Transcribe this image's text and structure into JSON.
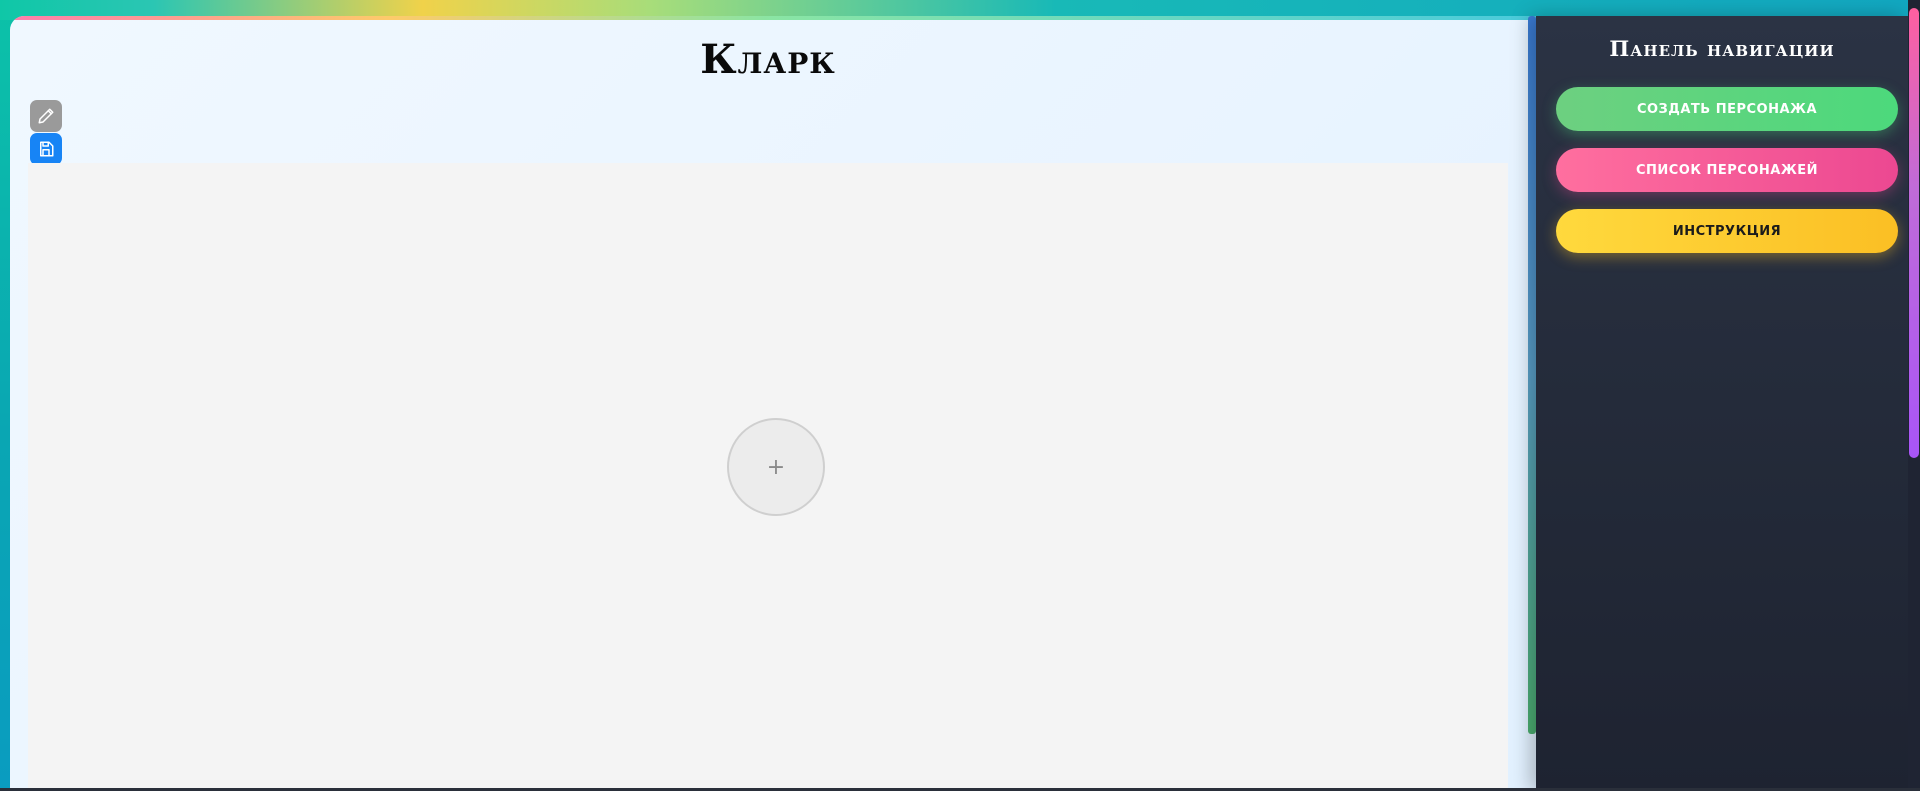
{
  "page": {
    "title": "Кларк"
  },
  "toolbar": {
    "edit_icon": "pencil-icon",
    "save_icon": "save-icon"
  },
  "canvas": {
    "add_symbol": "+"
  },
  "navigation": {
    "title": "Панель навигации",
    "buttons": [
      {
        "label": "Создать персонажа",
        "color": "#4cd97c"
      },
      {
        "label": "Список персонажей",
        "color": "#ec4891"
      },
      {
        "label": "Инструкция",
        "color": "#fbbf24"
      }
    ]
  },
  "colors": {
    "accent_blue": "#1784f5",
    "nav_background": "#242b3a",
    "canvas_background": "#f4f4f4"
  }
}
